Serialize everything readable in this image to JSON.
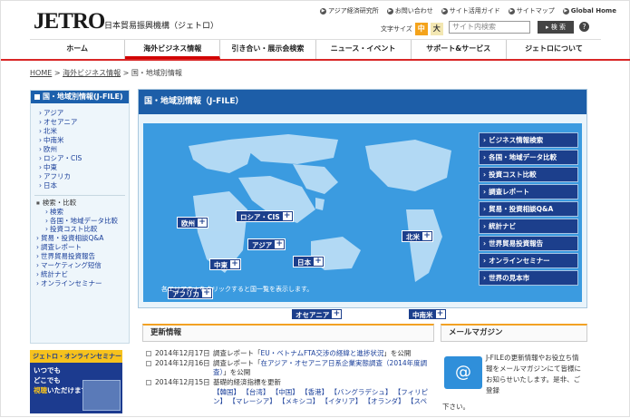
{
  "header": {
    "logo": "JETRO",
    "org_name": "日本貿易振興機構（ジェトロ）",
    "top_links": [
      "アジア経済研究所",
      "お問い合わせ",
      "サイト活用ガイド",
      "サイトマップ",
      "Global Home"
    ],
    "font_size_label": "文字サイズ",
    "font_size_medium": "中",
    "font_size_large": "大",
    "search_placeholder": "サイト内検索",
    "search_button": "検 索",
    "help": "?"
  },
  "nav": [
    "ホーム",
    "海外ビジネス情報",
    "引き合い・展示会検索",
    "ニュース・イベント",
    "サポート&サービス",
    "ジェトロについて"
  ],
  "breadcrumb": {
    "home": "HOME",
    "section": "海外ビジネス情報",
    "current": "国・地域別情報"
  },
  "sidebar": {
    "title": "国・地域別情報(J-FILE)",
    "regions": [
      "アジア",
      "オセアニア",
      "北米",
      "中南米",
      "欧州",
      "ロシア・CIS",
      "中東",
      "アフリカ",
      "日本"
    ],
    "search_compare": "検索・比較",
    "search_items": [
      "検索",
      "各国・地域データ比較",
      "投資コスト比較"
    ],
    "other": [
      "貿易・投資相談Q&A",
      "調査レポート",
      "世界貿易投資報告",
      "マーケティング短信",
      "統計ナビ",
      "オンラインセミナー"
    ]
  },
  "seminar_banner": {
    "title": "ジェトロ・オンラインセミナー",
    "line1": "いつでも",
    "line2": "どこでも",
    "line3_em": "視聴",
    "line3": "いただけます"
  },
  "main": {
    "title": "国・地域別情報（J-FILE）",
    "map_note": "各エリアの＋をクリックすると国一覧を表示します。",
    "map_regions": [
      "欧州",
      "ロシア・CIS",
      "アジア",
      "中東",
      "日本",
      "北米",
      "アフリカ",
      "オセアニア",
      "中南米"
    ],
    "links": [
      "ビジネス情報検索",
      "各国・地域データ比較",
      "投資コスト比較",
      "調査レポート",
      "貿易・投資相談Q&A",
      "統計ナビ",
      "世界貿易投資報告",
      "オンラインセミナー",
      "世界の見本市"
    ]
  },
  "news": {
    "title": "更新情報",
    "items": [
      {
        "date": "2014年12月17日",
        "pre": "調査レポート「",
        "link": "EU・ベトナムFTA交渉の経緯と進捗状況",
        "post": "」を公開"
      },
      {
        "date": "2014年12月16日",
        "pre": "調査レポート「",
        "link": "在アジア・オセアニア日系企業実態調査（2014年度調査）",
        "post": "」を公開"
      },
      {
        "date": "2014年12月15日",
        "pre": "",
        "link": "",
        "post": "基礎的経済指標を更新"
      }
    ],
    "tags": "【韓国】 【台湾】 【中国】 【香港】 【バングラデシュ】 【フィリピン】 【マレーシア】 【メキシコ】 【イタリア】 【オランダ】 【スペ"
  },
  "mail": {
    "title": "メールマガジン",
    "text": "J-FILEの更新情報やお役立ち情報をメールマガジンにて皆様にお知らせいたします。是非、ご登録",
    "text2": "下さい。"
  }
}
